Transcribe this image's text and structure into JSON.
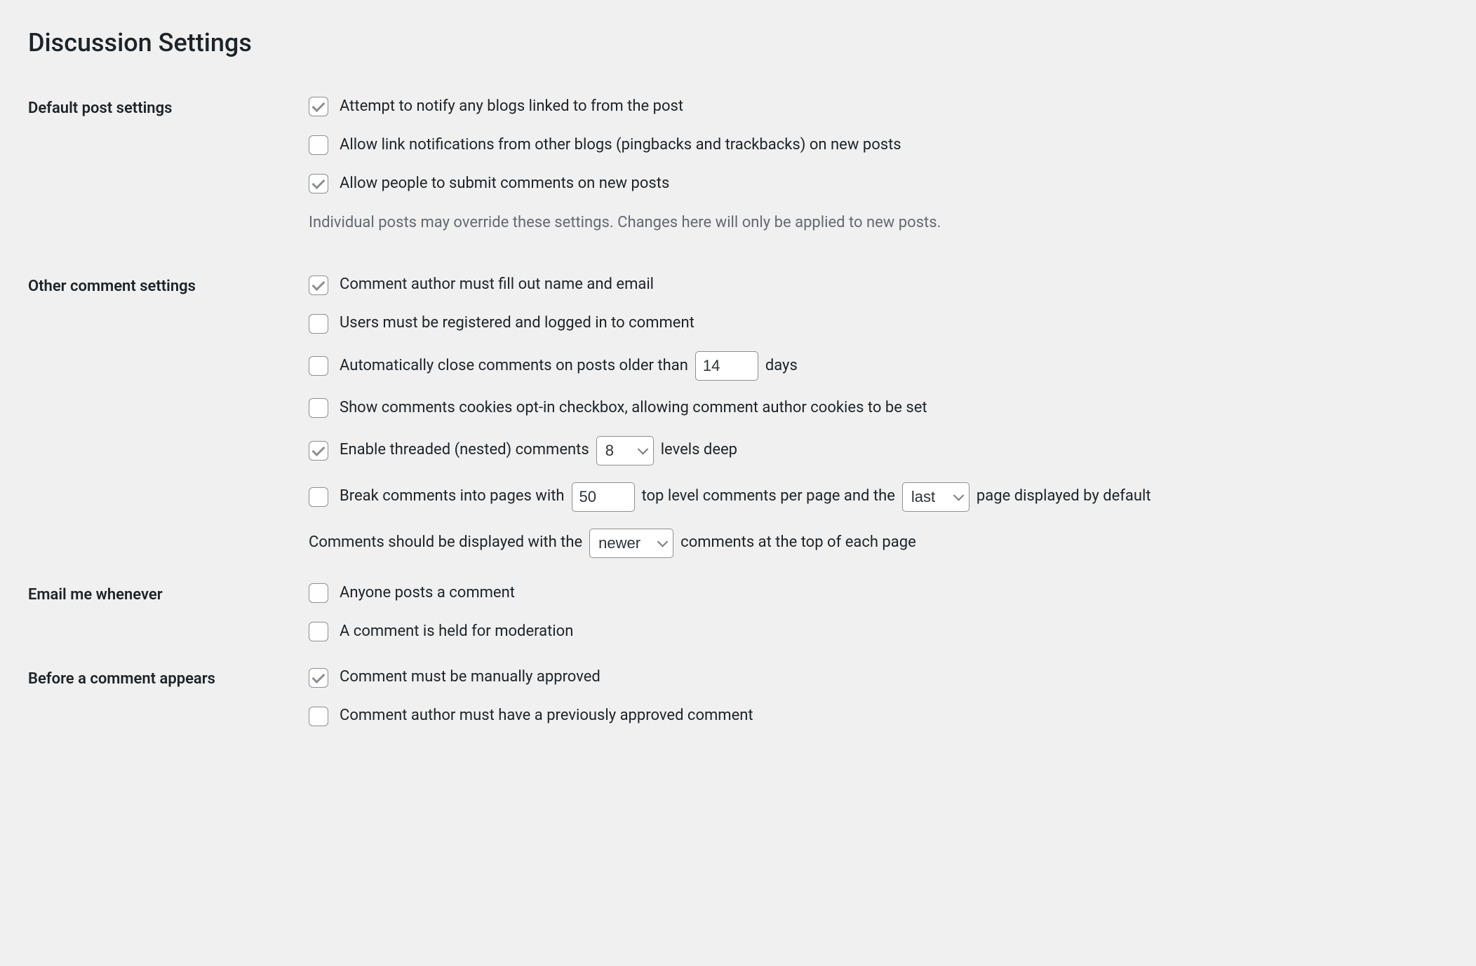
{
  "page_title": "Discussion Settings",
  "sections": {
    "default_post": {
      "heading": "Default post settings",
      "pingback_flag": {
        "label": "Attempt to notify any blogs linked to from the post",
        "checked": true
      },
      "ping_status": {
        "label": "Allow link notifications from other blogs (pingbacks and trackbacks) on new posts",
        "checked": false
      },
      "comment_status": {
        "label": "Allow people to submit comments on new posts",
        "checked": true
      },
      "description": "Individual posts may override these settings. Changes here will only be applied to new posts."
    },
    "other_comment": {
      "heading": "Other comment settings",
      "require_name_email": {
        "label": "Comment author must fill out name and email",
        "checked": true
      },
      "comment_registration": {
        "label": "Users must be registered and logged in to comment",
        "checked": false
      },
      "close_comments": {
        "label_before": "Automatically close comments on posts older than",
        "value": "14",
        "label_after": "days",
        "checked": false
      },
      "cookies_optin": {
        "label": "Show comments cookies opt-in checkbox, allowing comment author cookies to be set",
        "checked": false
      },
      "threaded": {
        "label_before": "Enable threaded (nested) comments",
        "value": "8",
        "label_after": "levels deep",
        "checked": true
      },
      "paginate": {
        "label_before": "Break comments into pages with",
        "per_page": "50",
        "label_mid": "top level comments per page and the",
        "default_page": "last",
        "label_after": "page displayed by default",
        "checked": false
      },
      "order": {
        "label_before": "Comments should be displayed with the",
        "value": "newer",
        "label_after": "comments at the top of each page"
      }
    },
    "email_me": {
      "heading": "Email me whenever",
      "anyone_posts": {
        "label": "Anyone posts a comment",
        "checked": false
      },
      "held_moderation": {
        "label": "A comment is held for moderation",
        "checked": false
      }
    },
    "before_appears": {
      "heading": "Before a comment appears",
      "manual_approve": {
        "label": "Comment must be manually approved",
        "checked": true
      },
      "previously_approved": {
        "label": "Comment author must have a previously approved comment",
        "checked": false
      }
    }
  }
}
